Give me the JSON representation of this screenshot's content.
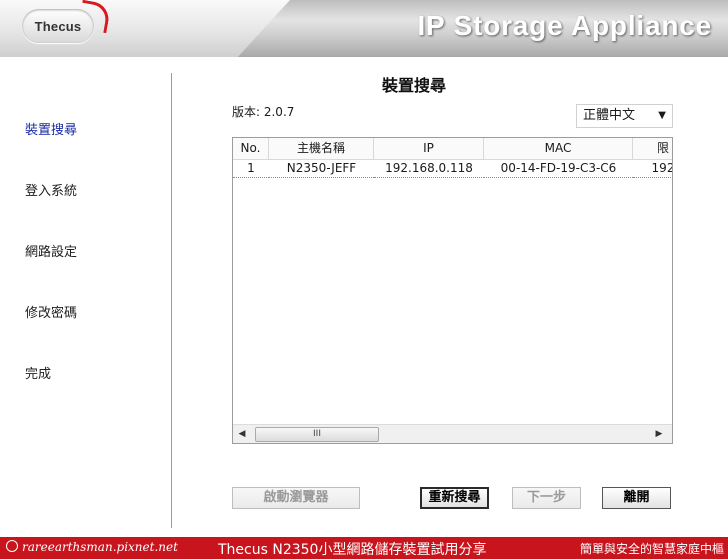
{
  "header": {
    "logo_text": "Thecus",
    "title": "IP Storage Appliance"
  },
  "sidebar": {
    "items": [
      {
        "label": "裝置搜尋",
        "active": true
      },
      {
        "label": "登入系統",
        "active": false
      },
      {
        "label": "網路設定",
        "active": false
      },
      {
        "label": "修改密碼",
        "active": false
      },
      {
        "label": "完成",
        "active": false
      }
    ]
  },
  "main": {
    "title": "裝置搜尋",
    "version": "版本: 2.0.7",
    "language": "正體中文",
    "table": {
      "headers": [
        "No.",
        "主機名稱",
        "IP",
        "MAC",
        "限"
      ],
      "rows": [
        [
          "1",
          "N2350-JEFF",
          "192.168.0.118",
          "00-14-FD-19-C3-C6",
          "192"
        ]
      ]
    },
    "scroll_thumb": "III"
  },
  "buttons": {
    "browse": "啟動瀏覽器",
    "rescan": "重新搜尋",
    "next": "下一步",
    "exit": "離開"
  },
  "footer": {
    "left": "rareearthsman.pixnet.net",
    "center": "Thecus N2350小型網路儲存裝置試用分享",
    "right": "簡單與安全的智慧家庭中樞"
  },
  "colors": {
    "accent_nav": "#1a2aa6",
    "footer_bg": "#c8141c",
    "logo_arc": "#d71920"
  }
}
